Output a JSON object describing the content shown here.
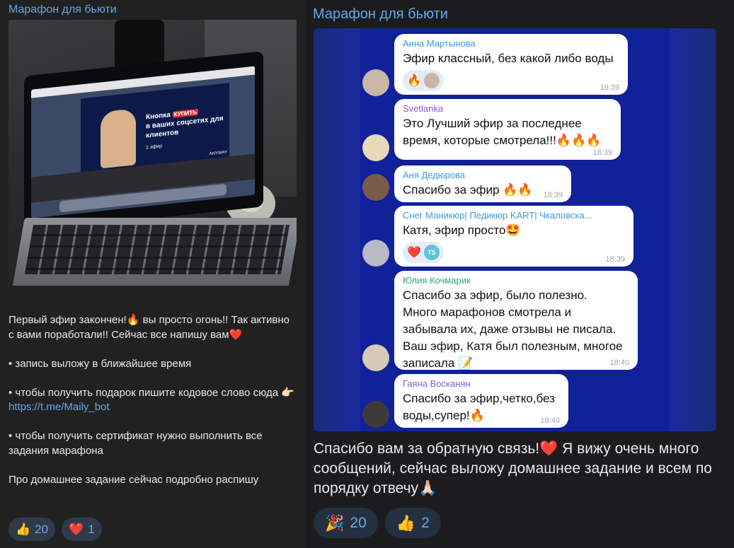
{
  "left_post": {
    "channel": "Марафон для бьюти",
    "photo_text": {
      "line1": "Кнопка",
      "button": "КУПИТЬ",
      "line2": "в ваших соцсетях для клиентов",
      "episode": "1 эфир",
      "brand": "ANYWAY"
    },
    "text_before_link": "Первый эфир закончен!🔥 вы просто огонь!! Так активно с вами поработали!! Сейчас все напишу вам❤️\n\n• запись выложу в ближайшее время\n\n• чтобы получить подарок пишите кодовое слово сюда 👉🏻 ",
    "link": "https://t.me/Maily_bot",
    "text_after_link": "\n\n• чтобы получить сертификат нужно выполнить все задания марафона\n\nПро домашнее задание сейчас подробно распишу",
    "reactions": [
      {
        "emoji": "👍",
        "count": "20"
      },
      {
        "emoji": "❤️",
        "count": "1"
      }
    ]
  },
  "right_post": {
    "channel": "Марафон для бьюти",
    "messages": [
      {
        "name": "Анна Мартынова",
        "name_color": "#3a9ad9",
        "text": "Эфир классный, без какой либо воды",
        "time": "18:39",
        "reaction": "🔥",
        "avatar_color": "#c9b7a6"
      },
      {
        "name": "Svetlanka",
        "name_color": "#8a5ad1",
        "text": "Это Лучший эфир за последнее\nвремя, которые смотрела!!!🔥🔥🔥",
        "time": "18:39",
        "avatar_color": "#e8d9b8"
      },
      {
        "name": "Аня Дедюрова",
        "name_color": "#3a9ad9",
        "text": "Спасибо за эфир 🔥🔥",
        "time": "18:39",
        "avatar_color": "#7a5a48"
      },
      {
        "name": "Снег Маникюр| Педикюр KART| Чкаловска...",
        "name_color": "#3a9ad9",
        "text": "Катя, эфир просто🤩",
        "time": "18:39",
        "reaction": "❤️",
        "reaction_badge": "TS",
        "avatar_color": "#b8b9c4"
      },
      {
        "name": "Юлия Кочмарик",
        "name_color": "#2aa38a",
        "text": "Спасибо за эфир, было полезно.\nМного марафонов смотрела и\nзабывала их, даже отзывы не писала.\nВаш эфир, Катя был полезным, многое\nзаписала 📝",
        "time": "18:40",
        "avatar_color": "#d8c8b8"
      },
      {
        "name": "Гаяна Восканян",
        "name_color": "#8a5ad1",
        "text": "Спасибо за эфир,четко,без\nводы,супер!🔥",
        "time": "18:40",
        "avatar_color": "#3e3a3a"
      }
    ],
    "text": "Спасибо вам за обратную связь!❤️ Я вижу очень много сообщений, сейчас выложу домашнее задание и всем по порядку отвечу🙏🏻",
    "reactions": [
      {
        "emoji": "🎉",
        "count": "20"
      },
      {
        "emoji": "👍",
        "count": "2"
      }
    ]
  }
}
